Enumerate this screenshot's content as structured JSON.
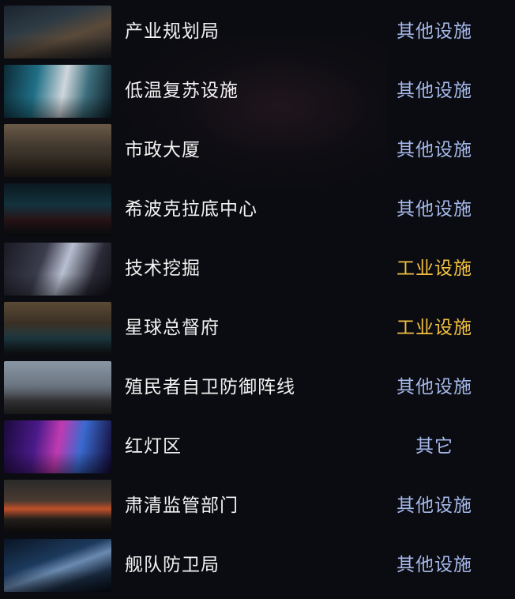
{
  "rows": [
    {
      "name": "产业规划局",
      "category": "其他设施",
      "category_type": "other"
    },
    {
      "name": "低温复苏设施",
      "category": "其他设施",
      "category_type": "other"
    },
    {
      "name": "市政大厦",
      "category": "其他设施",
      "category_type": "other"
    },
    {
      "name": "希波克拉底中心",
      "category": "其他设施",
      "category_type": "other"
    },
    {
      "name": "技术挖掘",
      "category": "工业设施",
      "category_type": "industrial"
    },
    {
      "name": "星球总督府",
      "category": "工业设施",
      "category_type": "industrial"
    },
    {
      "name": "殖民者自卫防御阵线",
      "category": "其他设施",
      "category_type": "other"
    },
    {
      "name": "红灯区",
      "category": "其它",
      "category_type": "other"
    },
    {
      "name": "肃清监管部门",
      "category": "其他设施",
      "category_type": "other"
    },
    {
      "name": "舰队防卫局",
      "category": "其他设施",
      "category_type": "other"
    }
  ],
  "colors": {
    "background": "#0b0c11",
    "name_text": "#f2f2f2",
    "category_other": "#a5b8ea",
    "category_industrial": "#f2c040"
  }
}
